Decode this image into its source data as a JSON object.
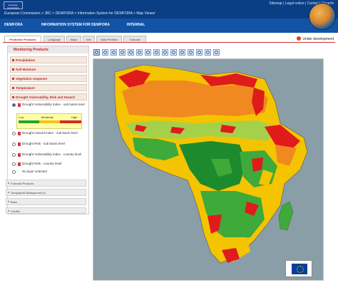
{
  "header": {
    "logo_text": "European Commission",
    "title": "European Commission > JRC > DEWFORA > Information System for DEWFORA > Map Viewer",
    "links": [
      "Sitemap",
      "Legal notice",
      "Contact",
      "Search"
    ]
  },
  "nav": {
    "items": [
      "DEWFORA",
      "INFORMATION SYSTEM FOR DEWFORA",
      "INTERNAL"
    ]
  },
  "tabs": [
    "Predictive Products",
    "Language",
    "Maps",
    "Info",
    "Data Portfolio",
    "Tutorials"
  ],
  "status": {
    "under_development": "Under development"
  },
  "panel": {
    "header": "Monitoring Products",
    "sections": [
      "Precipitation",
      "Soil Moisture",
      "Vegetation response",
      "Temperature",
      "Drought Vulnerability, Risk and Hazard"
    ],
    "layers": [
      {
        "label": "Drought Vulnerability Index - sub basin level",
        "selected": true
      },
      {
        "label": "Drought Hazard Index - sub basin level",
        "selected": false
      },
      {
        "label": "Drought Risk - sub basin level",
        "selected": false
      },
      {
        "label": "Drought Vulnerability Index - country level",
        "selected": false
      },
      {
        "label": "Drought Risk - country level",
        "selected": false
      },
      {
        "label": "No layer selected",
        "selected": false
      }
    ],
    "legend": {
      "low": "Low",
      "moderate": "Moderate",
      "high": "High"
    },
    "subsections": [
      "Forecast Products",
      "Geographic Background (1)",
      "Base",
      "Credits"
    ]
  },
  "map": {
    "category_colors": {
      "high": "#e01b1b",
      "medium": "#f5c400",
      "low": "#3eaa3a",
      "very_low": "#1e8a2e",
      "low_moderate": "#a5d14a",
      "moderate_high": "#f08a20",
      "ocean": "#8a9ea8"
    }
  },
  "toolbar": {
    "buttons": [
      "pan-icon",
      "zoom-in-icon",
      "zoom-out-icon",
      "zoom-box-icon",
      "zoom-extent-icon",
      "previous-extent-icon",
      "next-extent-icon",
      "identify-icon",
      "measure-icon",
      "refresh-icon",
      "info-icon",
      "print-icon",
      "legend-icon",
      "export-icon",
      "help-icon"
    ]
  }
}
